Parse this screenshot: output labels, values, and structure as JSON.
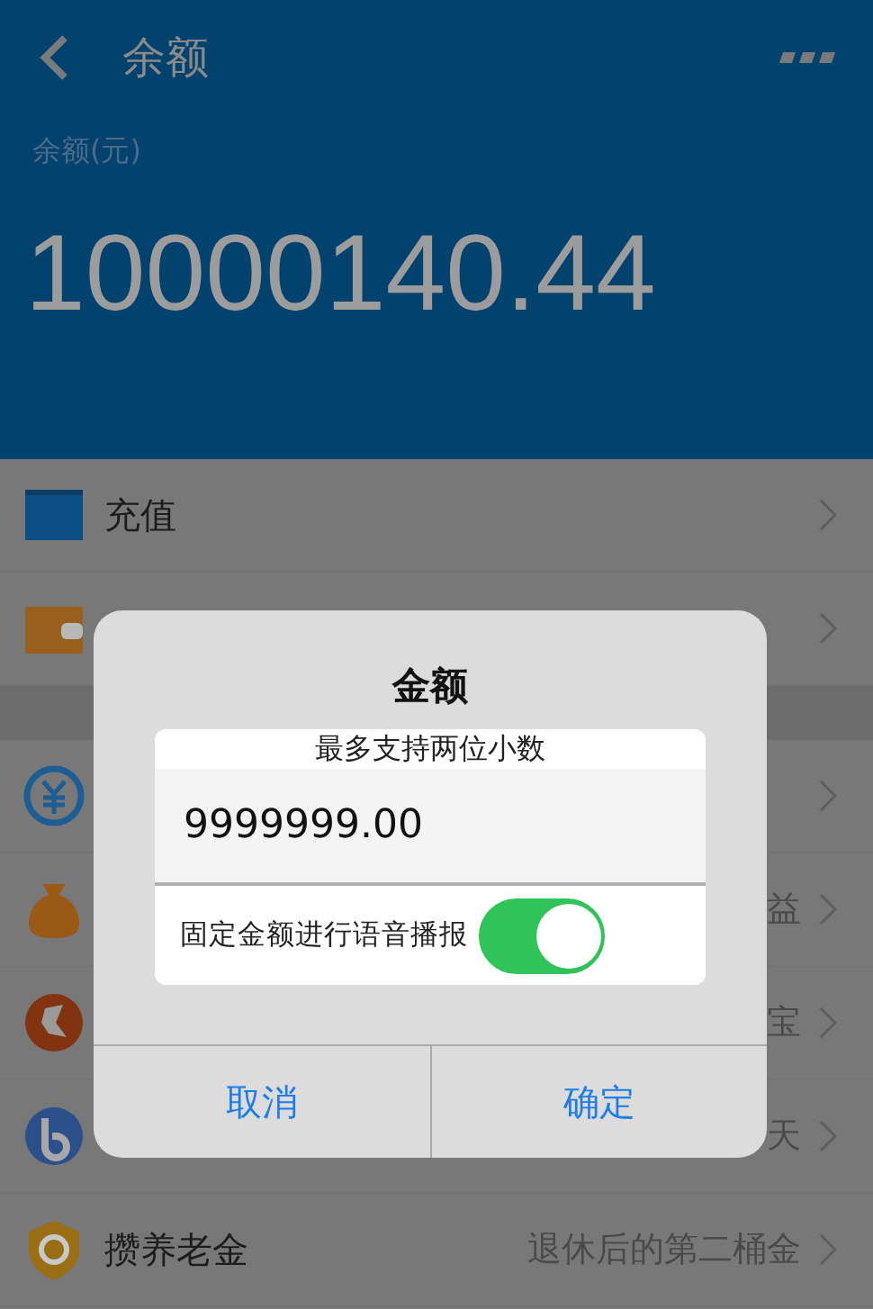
{
  "header": {
    "title": "余额",
    "balance_label": "余额(元)",
    "balance": "10000140.44"
  },
  "list": [
    {
      "kind": "row",
      "label": "充值"
    },
    {
      "kind": "row"
    },
    {
      "kind": "gap"
    },
    {
      "kind": "row"
    },
    {
      "kind": "row",
      "detail": "益"
    },
    {
      "kind": "row",
      "detail": "宝"
    },
    {
      "kind": "row",
      "detail": "天"
    },
    {
      "kind": "row",
      "label": "攒养老金",
      "detail": "退休后的第二桶金"
    }
  ],
  "dialog": {
    "title": "金额",
    "hint": "最多支持两位小数",
    "value": "9999999.00",
    "toggle": {
      "label": "固定金额进行语音播报",
      "on": true
    },
    "buttons": [
      "取消",
      "确定"
    ]
  }
}
